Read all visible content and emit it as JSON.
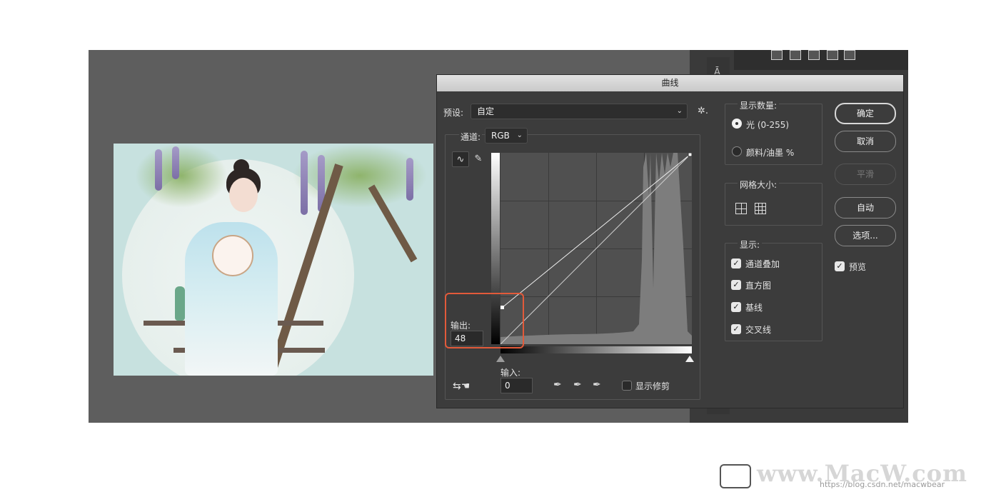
{
  "dialog": {
    "title": "曲线",
    "preset_label": "预设:",
    "preset_value": "自定",
    "channel_label": "通道:",
    "channel_value": "RGB",
    "output_label": "输出:",
    "output_value": "48",
    "input_label": "输入:",
    "input_value": "0",
    "show_clipping_label": "显示修剪",
    "display_amount": {
      "title": "显示数量:",
      "options": [
        "光 (0-255)",
        "颜料/油墨 %"
      ],
      "selected": "光 (0-255)"
    },
    "grid_size": {
      "title": "网格大小:"
    },
    "show": {
      "title": "显示:",
      "options": [
        {
          "label": "通道叠加",
          "checked": true
        },
        {
          "label": "直方图",
          "checked": true
        },
        {
          "label": "基线",
          "checked": true
        },
        {
          "label": "交叉线",
          "checked": true
        }
      ]
    },
    "buttons": {
      "ok": "确定",
      "cancel": "取消",
      "smooth": "平滑",
      "auto": "自动",
      "options": "选项..."
    },
    "preview_label": "预览",
    "preview_checked": true
  },
  "watermark": {
    "text": "www.MacW.com",
    "url": "https://blog.csdn.net/macwbear"
  },
  "colors": {
    "highlight": "#e25a3a",
    "dialog_bg": "#3c3c3c"
  }
}
